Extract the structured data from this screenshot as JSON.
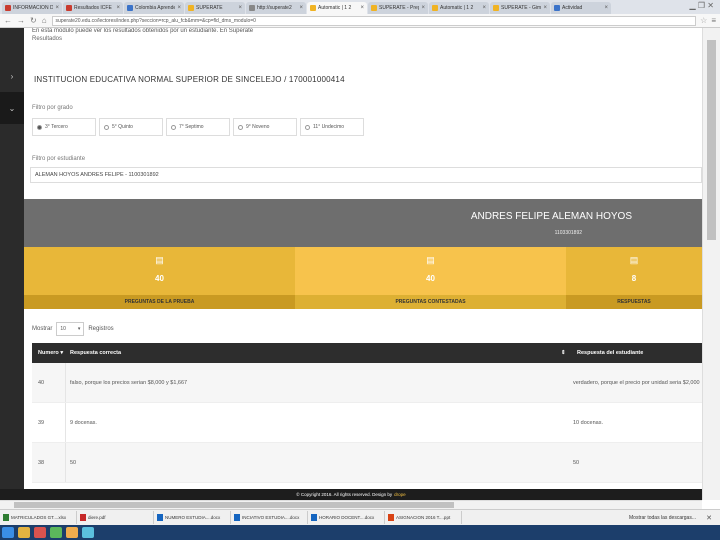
{
  "browser": {
    "tabs": [
      {
        "label": "INFORMACION DE L",
        "color": "#c93b2f"
      },
      {
        "label": "Resultados ICFE",
        "color": "#c93b2f"
      },
      {
        "label": "Colombia Aprende",
        "color": "#3b73c9"
      },
      {
        "label": "SUPERATE",
        "color": "#f0b323"
      },
      {
        "label": "http://superate2",
        "color": "#888888"
      },
      {
        "label": "Automatic | 1 2",
        "color": "#f0b323",
        "active": true
      },
      {
        "label": "SUPERATE - Pregunt",
        "color": "#f0b323"
      },
      {
        "label": "Automatic | 1 2",
        "color": "#f0b323"
      },
      {
        "label": "SUPERATE - Gimnasi",
        "color": "#f0b323"
      },
      {
        "label": "Actividad",
        "color": "#3b73c9"
      }
    ],
    "url": "superate20.edu.co/lectores/index.php?seccion=rcp_alu_fcb&mm=&cp=fld_dms_modulo=0"
  },
  "header": {
    "note": "En esta modulo puede ver los resultados obtenidos por un estudiante. En Superate",
    "results_label": "Resultados"
  },
  "institution": "INSTITUCION EDUCATIVA NORMAL SUPERIOR DE SINCELEJO / 170001000414",
  "filters": {
    "grade_label": "Filtro por grado",
    "grades": [
      {
        "label": "3° Tercero",
        "checked": true
      },
      {
        "label": "5° Quinto",
        "checked": false
      },
      {
        "label": "7° Septimo",
        "checked": false
      },
      {
        "label": "9° Noveno",
        "checked": false
      },
      {
        "label": "11° Undecimo",
        "checked": false
      }
    ],
    "student_label": "Filtro por estudiante",
    "student_value": "ALEMAN HOYOS ANDRES FELIPE - 1100301892"
  },
  "profile": {
    "name": "ANDRES FELIPE ALEMAN HOYOS",
    "id": "1103301892"
  },
  "stats": [
    {
      "value": "40",
      "label": "PREGUNTAS DE LA PRUEBA",
      "bg": "#e8b739",
      "foot": "#c99a22"
    },
    {
      "value": "40",
      "label": "PREGUNTAS CONTESTADAS",
      "bg": "#f7c34c",
      "foot": "#ddb033"
    },
    {
      "value": "8",
      "label": "RESPUESTAS",
      "bg": "#e8b739",
      "foot": "#c99a22"
    }
  ],
  "table": {
    "show_label": "Mostrar",
    "show_value": "10",
    "records_label": "Registros",
    "headers": {
      "number": "Numero",
      "correct": "Respuesta correcta",
      "student": "Respuesta del estudiante"
    },
    "rows": [
      {
        "number": "40",
        "correct": "falso, porque los precios serian $8,000 y $1,667",
        "student": "verdadero, porque el precio por unidad seria $2,000"
      },
      {
        "number": "39",
        "correct": "9 docenas.",
        "student": "10 docenas."
      },
      {
        "number": "38",
        "correct": "50",
        "student": "50"
      }
    ]
  },
  "footer": {
    "text": "© Copyright 2016. All rights reserved. Design by",
    "brand": "drope"
  },
  "downloads": {
    "items": [
      {
        "label": "MATRICULADOS GT....xlsx",
        "color": "#2e7d32"
      },
      {
        "label": "diere.pdf",
        "color": "#c62828"
      },
      {
        "label": "NUMERO ESTUDIA....docx",
        "color": "#1565c0"
      },
      {
        "label": "INCIATIVO ESTUDIA....docx",
        "color": "#1565c0"
      },
      {
        "label": "HORARIO DOCENT....docx",
        "color": "#1565c0"
      },
      {
        "label": "ASIGNACION 2016 T....ppt",
        "color": "#d84315"
      }
    ],
    "show_all": "Mostrar todas las descargas..."
  }
}
